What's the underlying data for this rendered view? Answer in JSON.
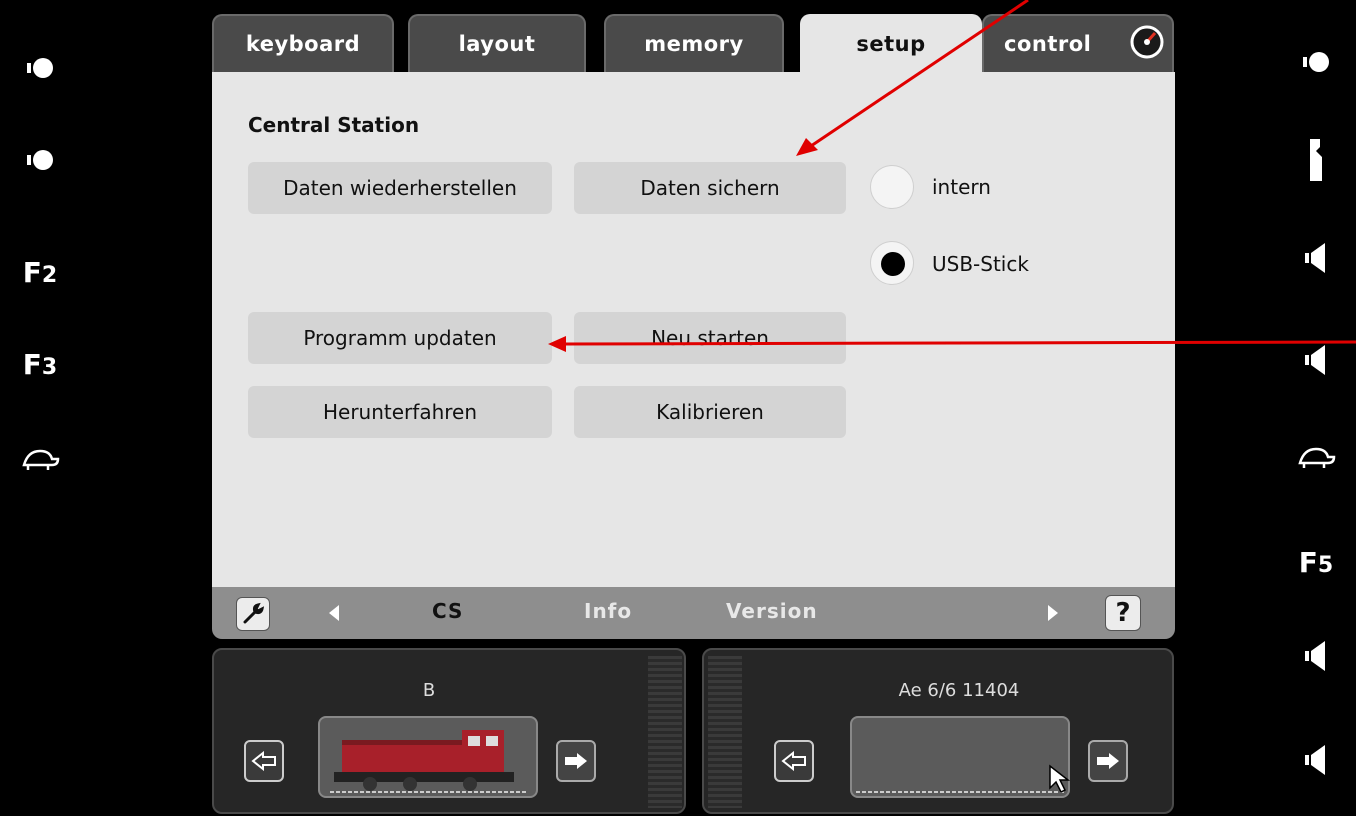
{
  "left_functions": [
    {
      "icon": "light-icon",
      "label": ""
    },
    {
      "icon": "light-icon",
      "label": ""
    },
    {
      "icon": "function-icon",
      "label": "F",
      "num": "2"
    },
    {
      "icon": "function-icon",
      "label": "F",
      "num": "3"
    },
    {
      "icon": "turtle-icon",
      "label": ""
    }
  ],
  "right_functions": [
    {
      "icon": "light-icon",
      "label": ""
    },
    {
      "icon": "coupler-icon",
      "label": ""
    },
    {
      "icon": "horn-icon",
      "label": ""
    },
    {
      "icon": "horn-icon",
      "label": ""
    },
    {
      "icon": "turtle-icon",
      "label": ""
    },
    {
      "icon": "function-icon",
      "label": "F",
      "num": "5"
    },
    {
      "icon": "horn-icon",
      "label": ""
    },
    {
      "icon": "horn-icon",
      "label": ""
    }
  ],
  "tabs": [
    {
      "label": "keyboard",
      "active": false
    },
    {
      "label": "layout",
      "active": false
    },
    {
      "label": "memory",
      "active": false
    },
    {
      "label": "setup",
      "active": true
    },
    {
      "label": "control",
      "active": false
    }
  ],
  "setup": {
    "section_title": "Central Station",
    "buttons": {
      "restore": "Daten wiederherstellen",
      "backup": "Daten sichern",
      "update": "Programm updaten",
      "restart": "Neu starten",
      "shutdown": "Herunterfahren",
      "calibrate": "Kalibrieren"
    },
    "storage": {
      "options": [
        "intern",
        "USB-Stick"
      ],
      "selected": "USB-Stick"
    }
  },
  "subnav": {
    "items": [
      {
        "label": "CS",
        "active": true
      },
      {
        "label": "Info",
        "active": false
      },
      {
        "label": "Version",
        "active": false
      }
    ],
    "help_label": "?"
  },
  "slots": {
    "left": {
      "name": "B"
    },
    "right": {
      "name": "Ae 6/6 11404"
    }
  },
  "colors": {
    "panel_bg": "#e6e6e6",
    "tab_inactive": "#4a4a4a",
    "annotation": "#e00000",
    "loco_red": "#a8202a"
  }
}
